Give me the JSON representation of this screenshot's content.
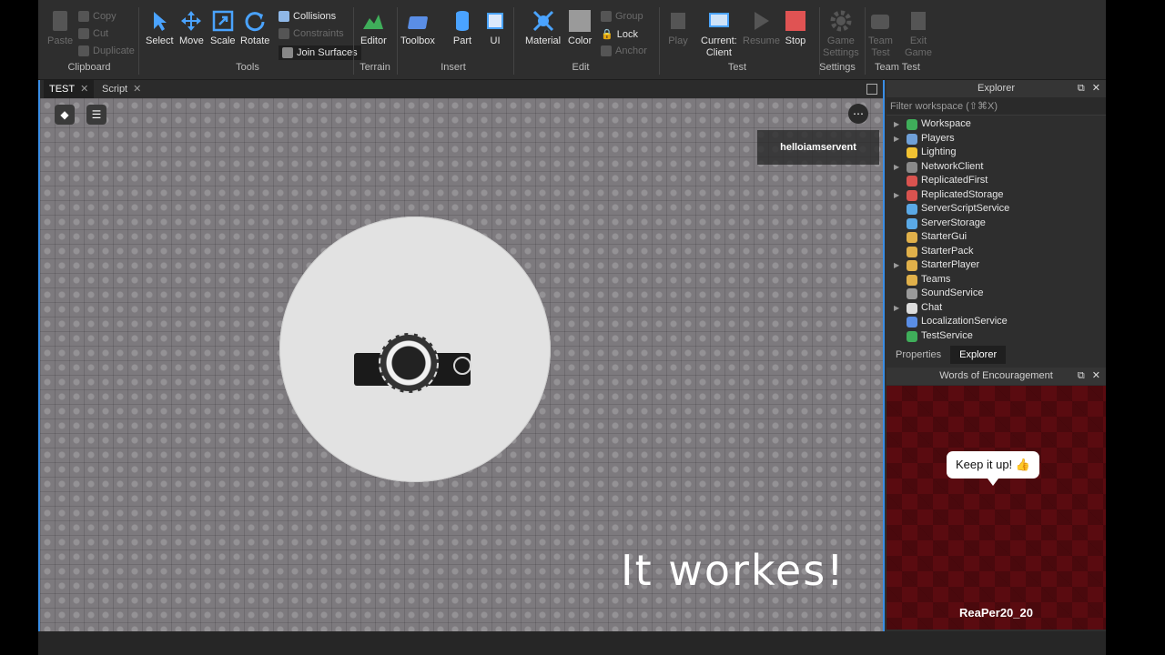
{
  "ribbon": {
    "clipboard": {
      "paste": "Paste",
      "copy": "Copy",
      "cut": "Cut",
      "duplicate": "Duplicate",
      "group": "Clipboard"
    },
    "tools": {
      "select": "Select",
      "move": "Move",
      "scale": "Scale",
      "rotate": "Rotate",
      "collisions": "Collisions",
      "constraints": "Constraints",
      "join": "Join Surfaces",
      "group": "Tools"
    },
    "terrain": {
      "editor": "Editor",
      "group": "Terrain"
    },
    "insert": {
      "toolbox": "Toolbox",
      "part": "Part",
      "ui": "UI",
      "group": "Insert"
    },
    "edit": {
      "material": "Material",
      "color": "Color",
      "group_btn": "Group",
      "lock": "Lock",
      "anchor": "Anchor",
      "group": "Edit"
    },
    "test": {
      "play": "Play",
      "current": "Current:",
      "client": "Client",
      "resume": "Resume",
      "stop": "Stop",
      "group": "Test"
    },
    "settings": {
      "game": "Game",
      "settings_btn": "Settings",
      "group": "Settings"
    },
    "teamtest": {
      "team": "Team",
      "test": "Test",
      "exit": "Exit",
      "game": "Game",
      "group": "Team Test"
    }
  },
  "tabs": [
    {
      "label": "TEST"
    },
    {
      "label": "Script"
    }
  ],
  "viewport": {
    "player_name": "helloiamservent",
    "caption": "It workes!"
  },
  "explorer": {
    "title": "Explorer",
    "filter_placeholder": "Filter workspace (⇧⌘X)",
    "items": [
      {
        "label": "Workspace",
        "expandable": true,
        "color": "#3fae5a"
      },
      {
        "label": "Players",
        "expandable": true,
        "color": "#6fa0d8"
      },
      {
        "label": "Lighting",
        "expandable": false,
        "color": "#f1c232"
      },
      {
        "label": "NetworkClient",
        "expandable": true,
        "color": "#8a8a8a"
      },
      {
        "label": "ReplicatedFirst",
        "expandable": false,
        "color": "#d9534f"
      },
      {
        "label": "ReplicatedStorage",
        "expandable": true,
        "color": "#d9534f"
      },
      {
        "label": "ServerScriptService",
        "expandable": false,
        "color": "#5aa9e6"
      },
      {
        "label": "ServerStorage",
        "expandable": false,
        "color": "#5aa9e6"
      },
      {
        "label": "StarterGui",
        "expandable": false,
        "color": "#e0b04a"
      },
      {
        "label": "StarterPack",
        "expandable": false,
        "color": "#e0b04a"
      },
      {
        "label": "StarterPlayer",
        "expandable": true,
        "color": "#e0b04a"
      },
      {
        "label": "Teams",
        "expandable": false,
        "color": "#e0b04a"
      },
      {
        "label": "SoundService",
        "expandable": false,
        "color": "#9a9a9a"
      },
      {
        "label": "Chat",
        "expandable": true,
        "color": "#dcdcdc"
      },
      {
        "label": "LocalizationService",
        "expandable": false,
        "color": "#5a8ee6"
      },
      {
        "label": "TestService",
        "expandable": false,
        "color": "#3fae5a"
      }
    ],
    "tabs": {
      "properties": "Properties",
      "explorer": "Explorer"
    }
  },
  "encouragement": {
    "title": "Words of Encouragement",
    "message": "Keep it up! 👍",
    "user": "ReaPer20_20"
  }
}
